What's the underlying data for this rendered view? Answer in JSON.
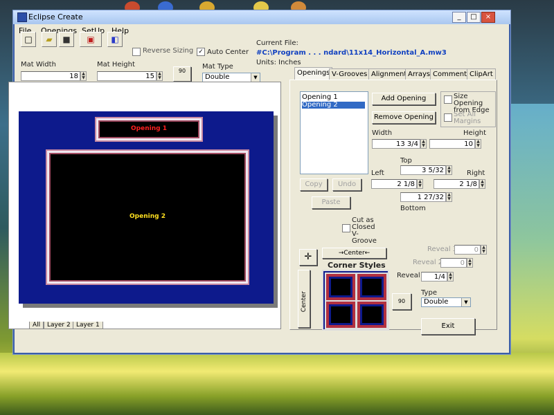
{
  "window": {
    "title": "Eclipse Create",
    "minimize": "_",
    "maximize": "□",
    "close": "×"
  },
  "menu": [
    "File",
    "Openings",
    "SetUp",
    "Help"
  ],
  "toolbar": {
    "reverse_sizing": "Reverse Sizing",
    "reverse_sizing_checked": false,
    "auto_center": "Auto Center",
    "auto_center_checked": true,
    "current_file_label": "Current File:",
    "current_file_value": "#C:\\Program . . . ndard\\11x14_Horizontal_A.mw3",
    "units": "Units: Inches"
  },
  "mat": {
    "width_label": "Mat Width",
    "width_value": "18",
    "height_label": "Mat Height",
    "height_value": "15",
    "type_label": "Mat Type",
    "type_value": "Double",
    "rotate_label": "90"
  },
  "canvas": {
    "opening1": "Opening 1",
    "opening2": "Opening 2",
    "colors": {
      "mat": "#0d1a8c",
      "opening1_text": "#ff2020",
      "opening2_text": "#ffe020"
    }
  },
  "layers": [
    "All",
    "Layer 2",
    "Layer 1"
  ],
  "tabs": [
    "Openings",
    "V-Grooves",
    "Alignment",
    "Arrays",
    "Comments",
    "ClipArt"
  ],
  "openings": {
    "items": [
      "Opening 1",
      "Opening 2"
    ],
    "selected_index": 1,
    "add": "Add Opening",
    "remove": "Remove Opening",
    "size_from_edge": "Size Opening from Edge",
    "set_all_margins": "Set All Margins",
    "copy": "Copy",
    "undo": "Undo",
    "paste": "Paste",
    "width_label": "Width",
    "width_value": "13 3/4",
    "height_label": "Height",
    "height_value": "10",
    "top_label": "Top",
    "top_value": "3 5/32",
    "left_label": "Left",
    "left_value": "2 1/8",
    "right_label": "Right",
    "right_value": "2 1/8",
    "bottom_value": "1 27/32",
    "bottom_label": "Bottom",
    "cut_closed": "Cut as Closed V-Groove",
    "center_h": "→Center←",
    "center_v": "Center",
    "corner_styles": "Corner Styles",
    "reveal3_label": "Reveal 3",
    "reveal3_value": "0",
    "reveal2_label": "Reveal 2",
    "reveal2_value": "0",
    "reveal_label": "Reveal",
    "reveal_value": "1/4",
    "type_label": "Type",
    "type_value": "Double",
    "rotate_label": "90",
    "exit": "Exit"
  }
}
